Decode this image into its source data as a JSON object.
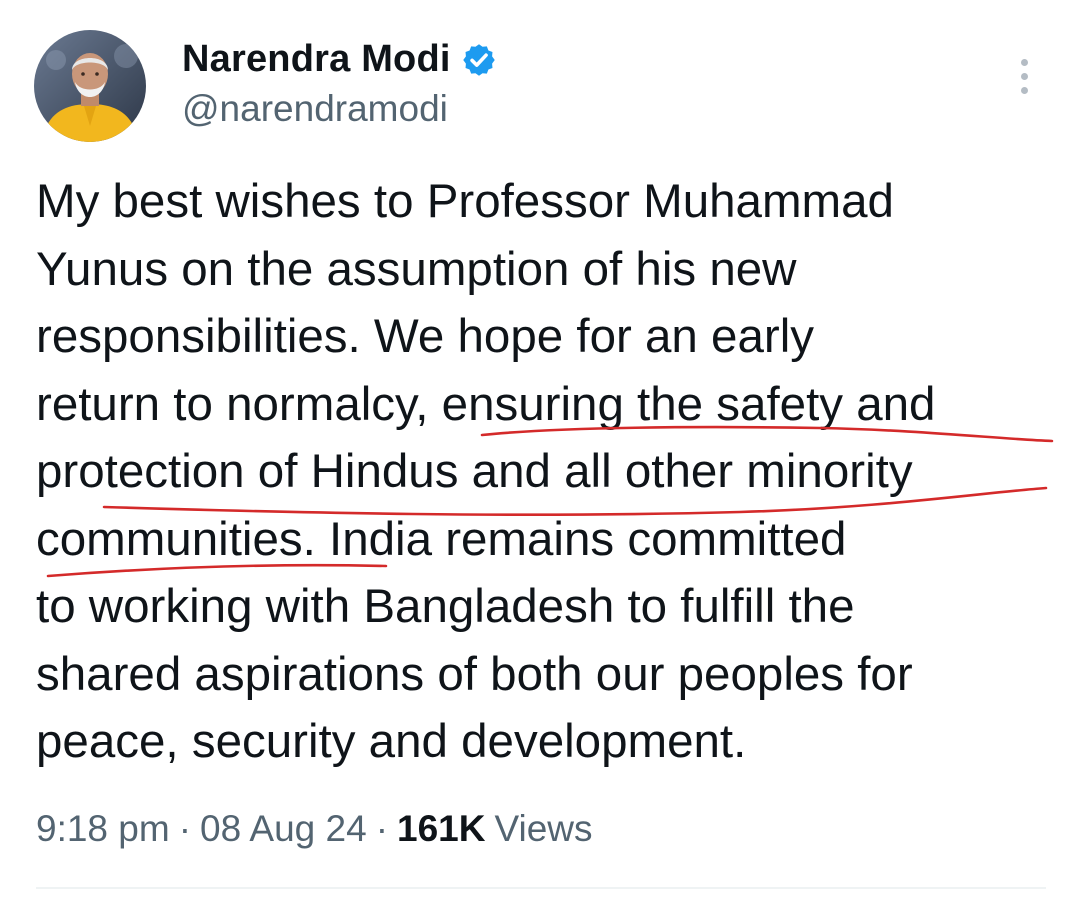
{
  "author": {
    "display_name": "Narendra Modi",
    "handle": "@narendramodi",
    "verified": true,
    "verified_color": "#1d9bf0"
  },
  "tweet": {
    "lines": [
      "My best wishes to Professor Muhammad",
      "Yunus on the assumption of his new",
      "responsibilities. We hope for an early",
      "return to normalcy, ensuring the safety and",
      "protection of Hindus and all other minority",
      "communities. India remains committed",
      "to working with Bangladesh to fulfill the",
      "shared aspirations of both our peoples for",
      "peace, security and development."
    ]
  },
  "meta": {
    "time": "9:18 pm",
    "separator": "·",
    "date": "08 Aug 24",
    "views_count": "161K",
    "views_label": "Views"
  },
  "icons": {
    "verified": "verified-badge-icon",
    "more": "more-options-icon"
  },
  "colors": {
    "text": "#0f1419",
    "secondary_text": "#536471",
    "annotation_red": "#d42a2a"
  }
}
